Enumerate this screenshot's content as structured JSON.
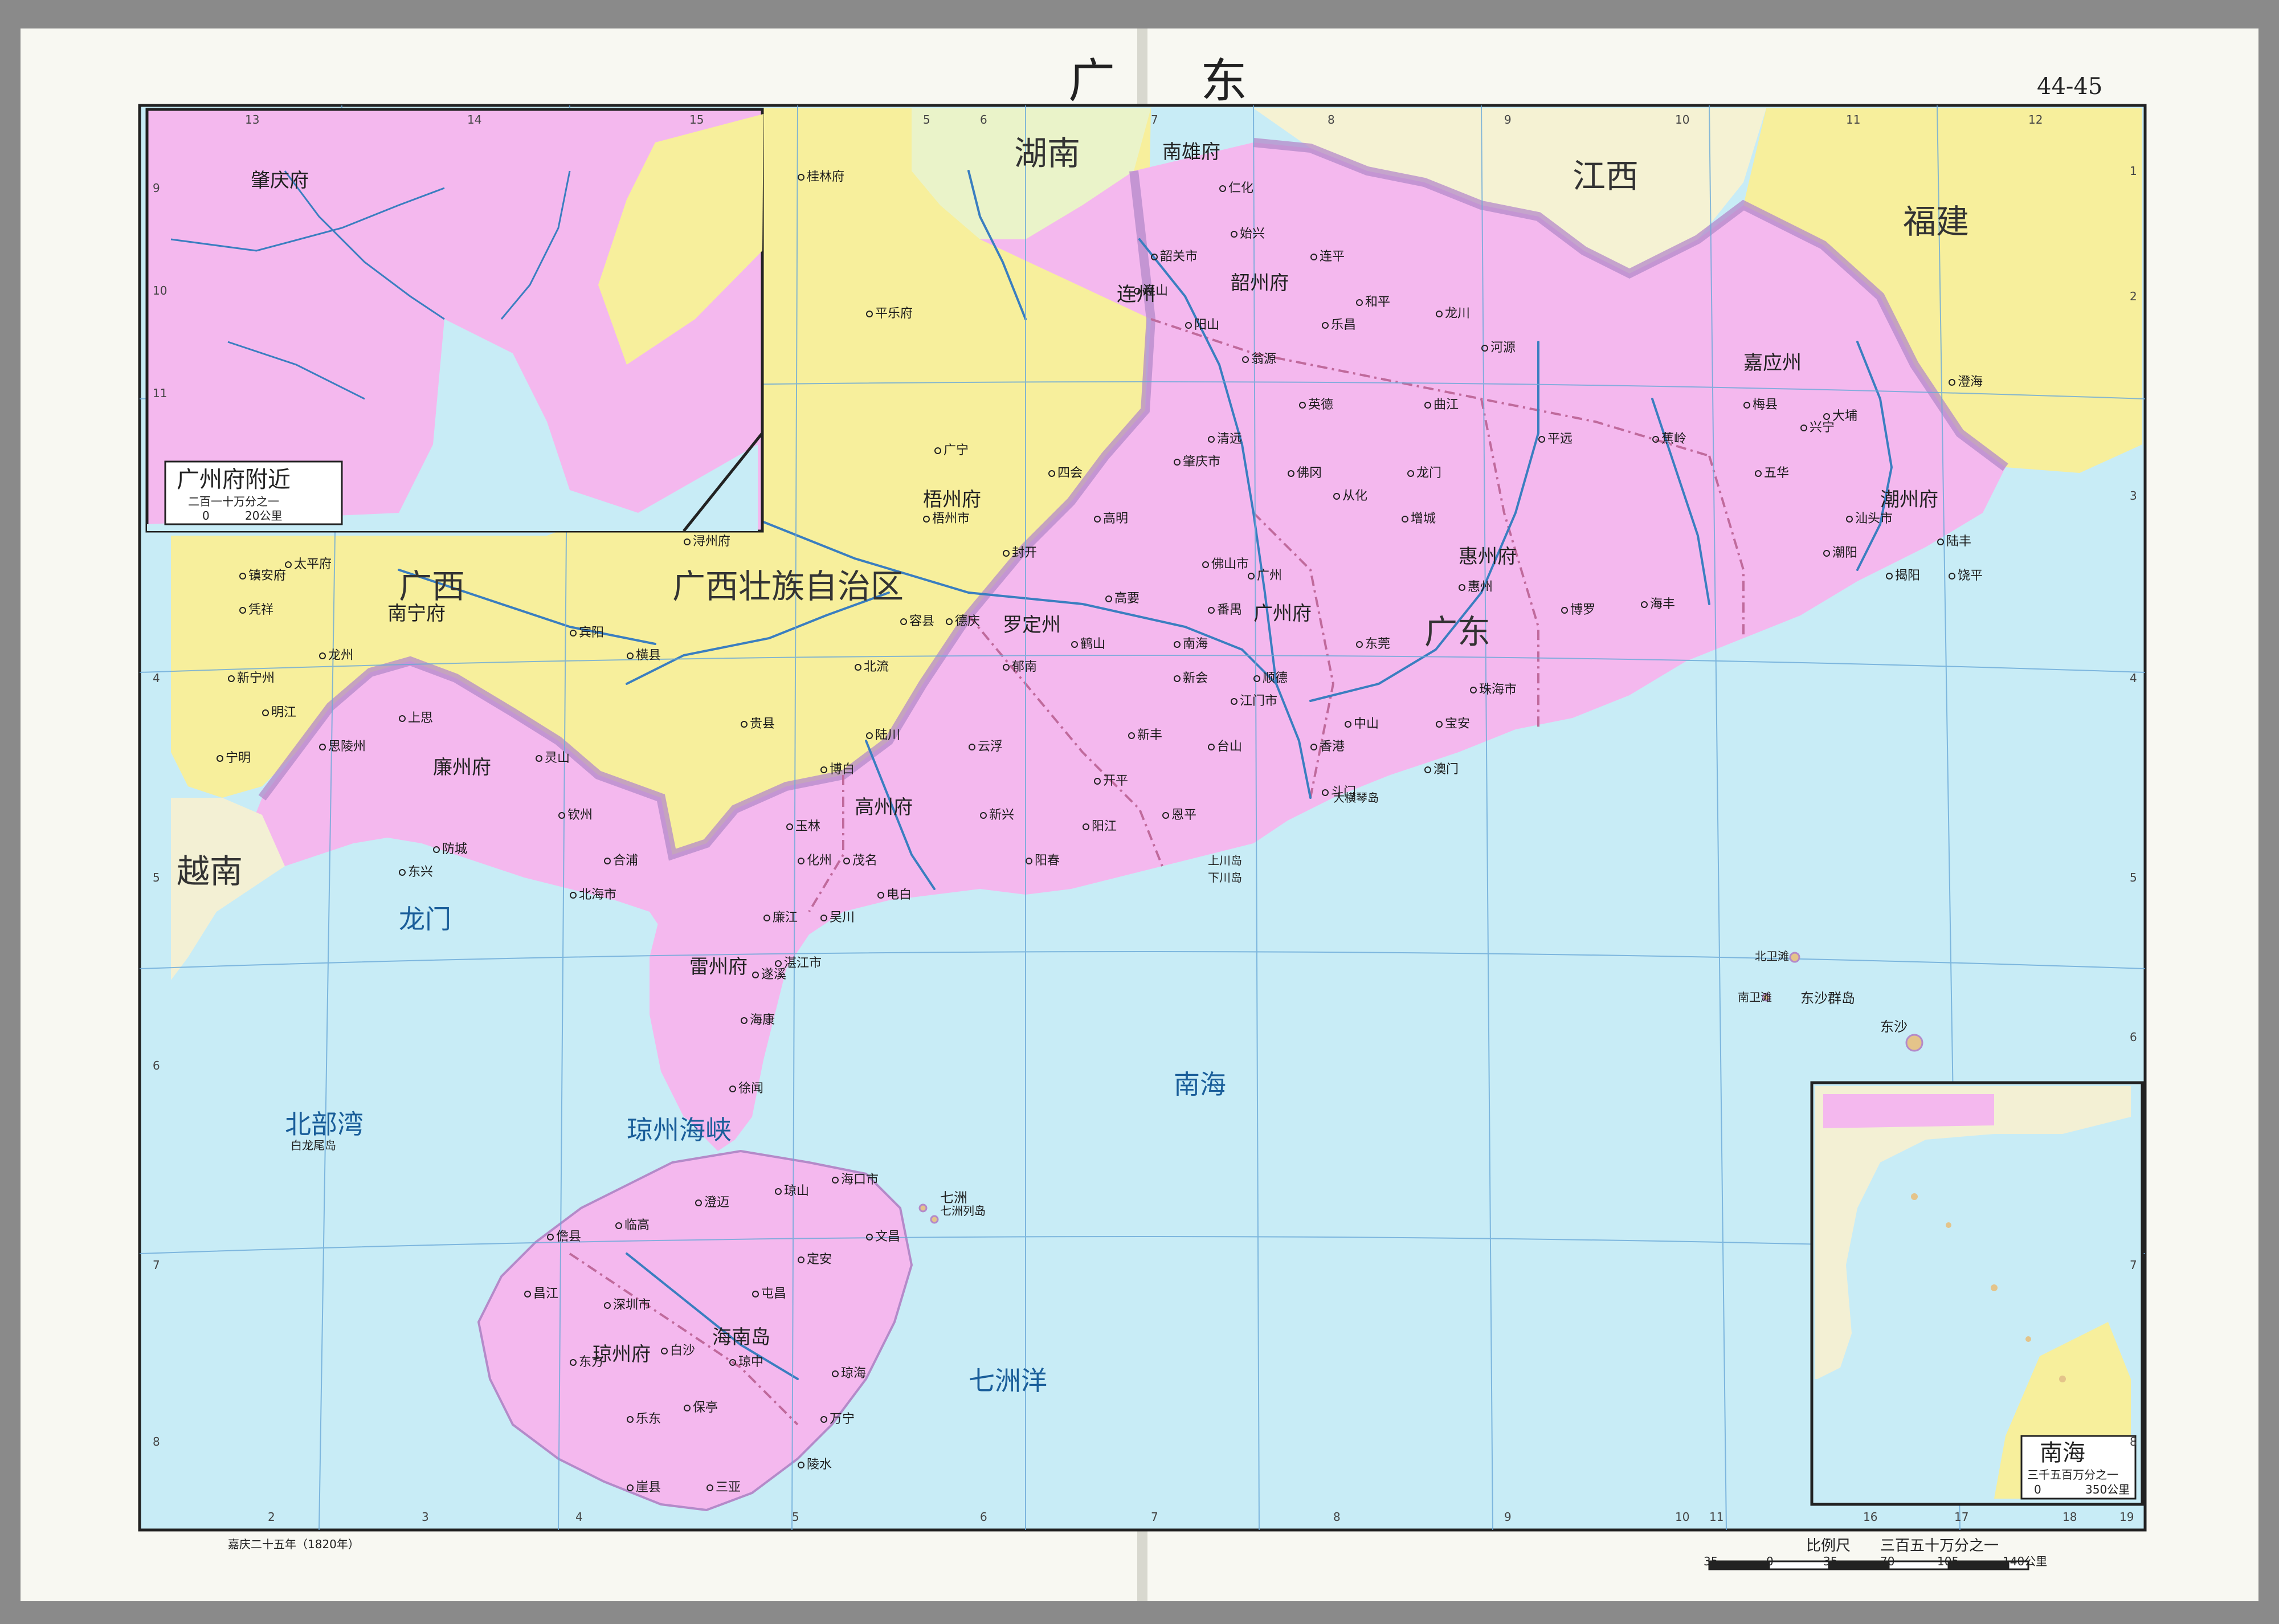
{
  "page": {
    "title": "广东",
    "page_number": "44-45",
    "date_note": "嘉庆二十五年（1820年）"
  },
  "scale_bar": {
    "label": "比例尺",
    "ratio": "三百五十万分之一",
    "ticks": [
      "35",
      "0",
      "35",
      "70",
      "105",
      "140公里"
    ]
  },
  "inset_guangzhou": {
    "title": "广州府附近",
    "scale": "二百一十万分之一",
    "ticks": [
      "0",
      "20公里"
    ]
  },
  "inset_south_sea": {
    "title": "南海",
    "scale": "三千五百万分之一",
    "ticks": [
      "0",
      "350公里"
    ]
  },
  "grid_columns_top": [
    "13",
    "14",
    "15",
    "5",
    "6",
    "7",
    "8",
    "9",
    "10",
    "11",
    "12"
  ],
  "grid_columns_bottom": [
    "2",
    "3",
    "4",
    "5",
    "6",
    "7",
    "8",
    "9",
    "10",
    "11",
    "16",
    "17",
    "18",
    "19"
  ],
  "grid_rows_left": [
    "9",
    "10",
    "11",
    "4",
    "5",
    "6",
    "7",
    "8"
  ],
  "grid_rows_right": [
    "1",
    "2",
    "3",
    "4",
    "5",
    "6",
    "7",
    "8"
  ],
  "regions": {
    "guangdong": "广东",
    "guangxi": "广西",
    "guangxi_zhuang": "广西壮族自治区",
    "hunan": "湖南",
    "jiangxi": "江西",
    "fujian": "福建",
    "yuenan": "越南"
  },
  "prefectures": [
    "广州府",
    "肇庆府",
    "惠州府",
    "韶州府",
    "南雄府",
    "潮州府",
    "嘉应州",
    "罗定州",
    "高州府",
    "廉州府",
    "雷州府",
    "琼州府",
    "连州",
    "南宁府",
    "梧州府"
  ],
  "water_bodies": [
    "南海",
    "北部湾",
    "琼州海峡",
    "龙门",
    "七洲洋"
  ],
  "islands": [
    "东沙群岛",
    "东沙",
    "北卫滩",
    "南卫滩",
    "七洲",
    "七洲列岛",
    "白龙尾岛",
    "海南岛",
    "大横琴岛",
    "上川岛",
    "下川岛"
  ],
  "cities": [
    "广州",
    "韶关市",
    "连山",
    "阳山",
    "英德",
    "清远",
    "佛冈",
    "从化",
    "龙门",
    "增城",
    "惠州",
    "博罗",
    "海丰",
    "陆丰",
    "汕头市",
    "潮阳",
    "揭阳",
    "饶平",
    "澄海",
    "大埔",
    "梅县",
    "兴宁",
    "五华",
    "平远",
    "蕉岭",
    "河源",
    "龙川",
    "和平",
    "连平",
    "始兴",
    "仁化",
    "乐昌",
    "翁源",
    "曲江",
    "新丰",
    "开平",
    "恩平",
    "台山",
    "新会",
    "江门市",
    "鹤山",
    "高要",
    "高明",
    "四会",
    "广宁",
    "封开",
    "德庆",
    "郁南",
    "云浮",
    "新兴",
    "阳江",
    "阳春",
    "电白",
    "茂名",
    "化州",
    "吴川",
    "廉江",
    "遂溪",
    "海康",
    "徐闻",
    "湛江市",
    "北海市",
    "合浦",
    "钦州",
    "灵山",
    "防城",
    "东兴",
    "海口市",
    "琼山",
    "文昌",
    "定安",
    "琼海",
    "万宁",
    "陵水",
    "三亚",
    "崖县",
    "乐东",
    "东方",
    "昌江",
    "儋县",
    "临高",
    "澄迈",
    "屯昌",
    "琼中",
    "保亭",
    "白沙",
    "深圳市",
    "珠海市",
    "香港",
    "澳门",
    "中山",
    "顺德",
    "南海",
    "番禺",
    "东莞",
    "宝安",
    "斗门",
    "佛山市",
    "肇庆市",
    "梧州市",
    "桂林府",
    "平乐府",
    "容县",
    "北流",
    "陆川",
    "博白",
    "玉林",
    "贵县",
    "浔州府",
    "横县",
    "宾阳",
    "上思",
    "思陵州",
    "宁明",
    "明江",
    "龙州",
    "凭祥",
    "新宁州",
    "太平府",
    "镇安府"
  ],
  "colors": {
    "sea": "#c8ecf6",
    "guangdong_land": "#f4b8ee",
    "guangxi_land": "#f7ef9c",
    "neighbor_land": "#f3f0d4",
    "province_border": "#b48ac9",
    "river": "#3a7ec0",
    "frame": "#222222"
  }
}
